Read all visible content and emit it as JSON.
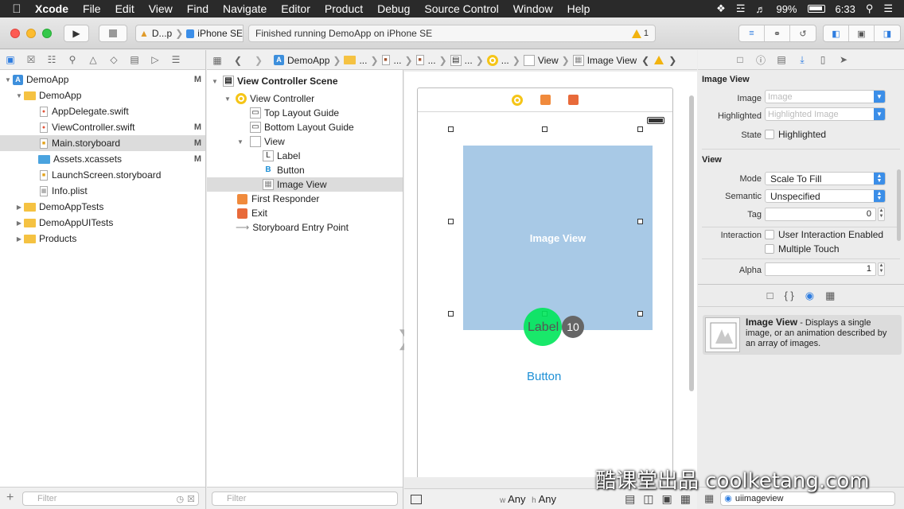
{
  "menubar": {
    "app": "Xcode",
    "items": [
      "File",
      "Edit",
      "View",
      "Find",
      "Navigate",
      "Editor",
      "Product",
      "Debug",
      "Source Control",
      "Window",
      "Help"
    ],
    "battery": "99%",
    "time": "6:33"
  },
  "toolbar": {
    "scheme": "D...p",
    "device": "iPhone SE",
    "status": "Finished running DemoApp on iPhone SE",
    "warning_count": "1"
  },
  "navigator": {
    "items": [
      {
        "label": "DemoApp",
        "badge": "M"
      },
      {
        "label": "DemoApp",
        "badge": ""
      },
      {
        "label": "AppDelegate.swift",
        "badge": ""
      },
      {
        "label": "ViewController.swift",
        "badge": "M"
      },
      {
        "label": "Main.storyboard",
        "badge": "M"
      },
      {
        "label": "Assets.xcassets",
        "badge": "M"
      },
      {
        "label": "LaunchScreen.storyboard",
        "badge": ""
      },
      {
        "label": "Info.plist",
        "badge": ""
      },
      {
        "label": "DemoAppTests",
        "badge": ""
      },
      {
        "label": "DemoAppUITests",
        "badge": ""
      },
      {
        "label": "Products",
        "badge": ""
      }
    ],
    "filter_placeholder": "Filter"
  },
  "jumpbar": {
    "items": [
      "DemoApp",
      "...",
      "...",
      "...",
      "...",
      "...",
      "View",
      "Image View"
    ]
  },
  "outline": {
    "items": [
      {
        "label": "View Controller Scene"
      },
      {
        "label": "View Controller"
      },
      {
        "label": "Top Layout Guide"
      },
      {
        "label": "Bottom Layout Guide"
      },
      {
        "label": "View"
      },
      {
        "label": "Label"
      },
      {
        "label": "Button"
      },
      {
        "label": "Image View"
      },
      {
        "label": "First Responder"
      },
      {
        "label": "Exit"
      },
      {
        "label": "Storyboard Entry Point"
      }
    ],
    "filter_placeholder": "Filter"
  },
  "canvas": {
    "image_view_text": "Image View",
    "label_text": "Label",
    "click_count": "10",
    "button_text": "Button",
    "size_w_prefix": "w",
    "size_w": "Any",
    "size_h_prefix": "h",
    "size_h": "Any"
  },
  "inspector": {
    "image_view_title": "Image View",
    "image_label": "Image",
    "image_placeholder": "Image",
    "highlighted_label": "Highlighted",
    "highlighted_placeholder": "Highlighted Image",
    "state_label": "State",
    "state_option": "Highlighted",
    "view_title": "View",
    "mode_label": "Mode",
    "mode_value": "Scale To Fill",
    "semantic_label": "Semantic",
    "semantic_value": "Unspecified",
    "tag_label": "Tag",
    "tag_value": "0",
    "interaction_label": "Interaction",
    "interaction_option1": "User Interaction Enabled",
    "interaction_option2": "Multiple Touch",
    "alpha_label": "Alpha",
    "alpha_value": "1"
  },
  "library": {
    "item_title": "Image View",
    "item_desc": " - Displays a single image, or an animation described by an array of images.",
    "search_value": "uiimageview"
  },
  "watermark": "酷课堂出品 coolketang.com"
}
